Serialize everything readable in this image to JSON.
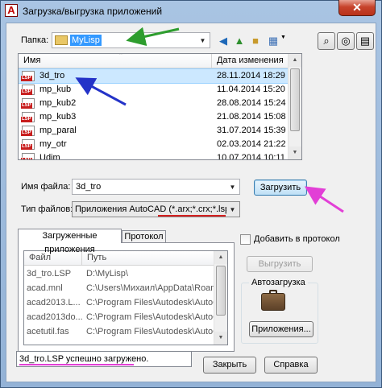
{
  "window": {
    "title": "Загрузка/выгрузка приложений",
    "close_glyph": "✕"
  },
  "folder": {
    "label": "Папка:",
    "value": "MyLisp"
  },
  "file_list": {
    "columns": [
      "Имя",
      "Дата изменения"
    ],
    "rows": [
      {
        "name": "3d_tro",
        "date": "28.11.2014 18:29"
      },
      {
        "name": "mp_kub",
        "date": "11.04.2014 15:20"
      },
      {
        "name": "mp_kub2",
        "date": "28.08.2014 15:24"
      },
      {
        "name": "mp_kub3",
        "date": "21.08.2014 15:08"
      },
      {
        "name": "mp_paral",
        "date": "31.07.2014 15:39"
      },
      {
        "name": "my_otr",
        "date": "02.03.2014 21:22"
      },
      {
        "name": "Udim",
        "date": "10.07.2014 10:11"
      }
    ]
  },
  "filename": {
    "label": "Имя файла:",
    "value": "3d_tro"
  },
  "filetype": {
    "label": "Тип файлов:",
    "value": "Приложения AutoCAD (*.arx;*.crx;*.lsp;*.dvb"
  },
  "buttons": {
    "load": "Загрузить",
    "unload": "Выгрузить",
    "apps": "Приложения...",
    "close": "Закрыть",
    "help": "Справка"
  },
  "tabs": {
    "loaded": "Загруженные приложения",
    "history": "Протокол"
  },
  "add_to_history": "Добавить в протокол",
  "loaded_list": {
    "columns": [
      "Файл",
      "Путь"
    ],
    "rows": [
      {
        "file": "3d_tro.LSP",
        "path": "D:\\MyLisp\\"
      },
      {
        "file": "acad.mnl",
        "path": "C:\\Users\\Михаил\\AppData\\Roami..."
      },
      {
        "file": "acad2013.L...",
        "path": "C:\\Program Files\\Autodesk\\AutoCA..."
      },
      {
        "file": "acad2013do...",
        "path": "C:\\Program Files\\Autodesk\\AutoCA..."
      },
      {
        "file": "acetutil.fas",
        "path": "C:\\Program Files\\Autodesk\\AutoCA..."
      }
    ]
  },
  "startup_suite": {
    "label": "Автозагрузка"
  },
  "status": {
    "text": "3d_tro.LSP успешно загружено."
  },
  "colors": {
    "arrow_green": "#2e9d2e",
    "arrow_blue": "#2433c8",
    "arrow_magenta": "#e23fd6",
    "underline_red": "#d42020",
    "selection": "#3399ff"
  }
}
